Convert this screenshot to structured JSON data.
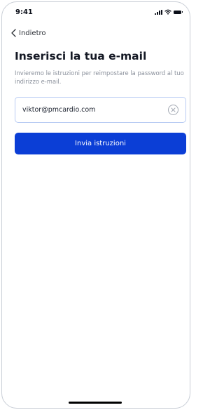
{
  "status_bar": {
    "time": "9:41"
  },
  "nav": {
    "back_label": "Indietro"
  },
  "main": {
    "title": "Inserisci la tua e-mail",
    "description": "Invieremo le istruzioni per reimpostare la password al tuo indirizzo e-mail.",
    "email_value": "viktor@pmcardio.com",
    "submit_label": "Invia istruzioni"
  },
  "colors": {
    "primary": "#0b3ed6",
    "input_border": "#b8cbf3",
    "muted_text": "#8a909b"
  },
  "icons": {
    "back": "chevron-left-icon",
    "clear": "clear-circle-icon",
    "signal": "signal-icon",
    "wifi": "wifi-icon",
    "battery": "battery-icon"
  }
}
